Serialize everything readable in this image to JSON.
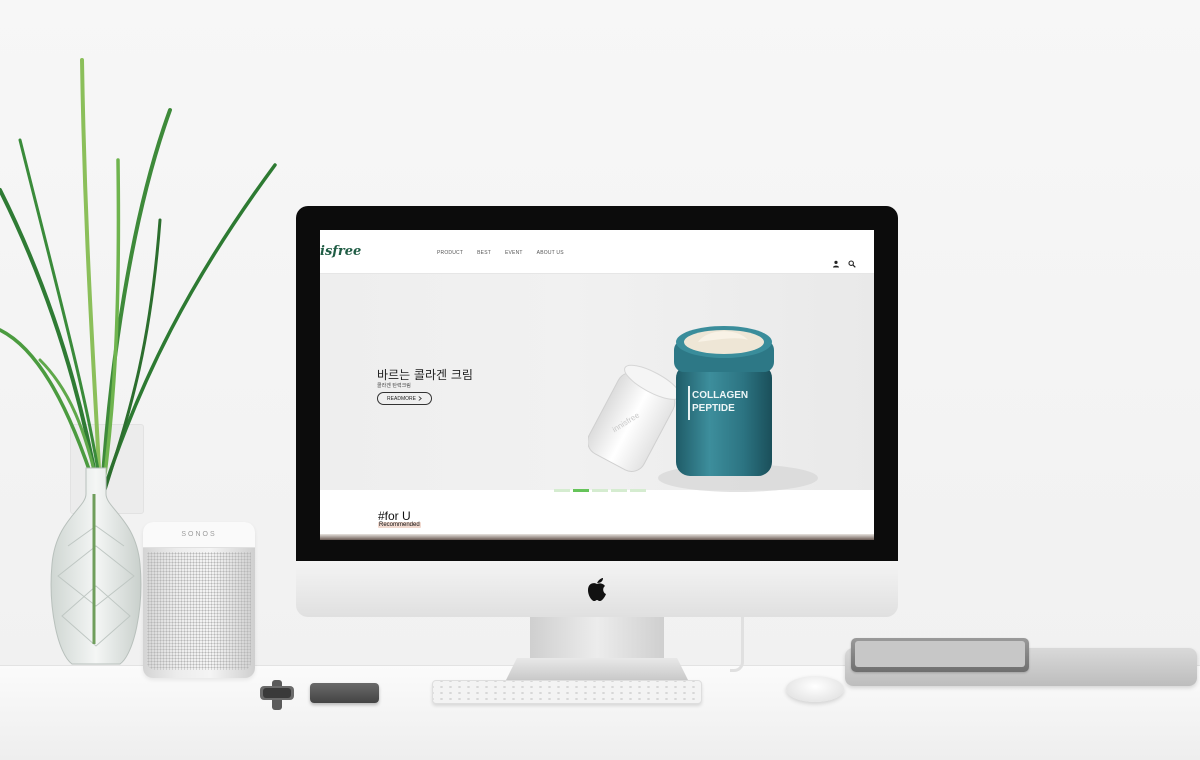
{
  "site": {
    "logo": "isfree",
    "nav": [
      "PRODUCT",
      "BEST",
      "EVENT",
      "ABOUT US"
    ],
    "header_icons": [
      "user-icon",
      "search-icon"
    ]
  },
  "hero": {
    "title": "바르는 콜라겐 크림",
    "subtitle": "콜라겐 탄력크림",
    "button_label": "READMORE",
    "product_jar_text": [
      "COLLAGEN",
      "PEPTIDE"
    ],
    "lid_text": "innisfree",
    "slides": 5,
    "active_slide": 2
  },
  "section": {
    "heading": "#for U",
    "label": "Recommended"
  },
  "scene": {
    "speaker_brand": "SONOS"
  },
  "colors": {
    "brand_green": "#1f5c44",
    "dot_active": "#66c45a",
    "dot_inactive": "#d5ecd0",
    "jar_teal": "#2f7a88"
  }
}
